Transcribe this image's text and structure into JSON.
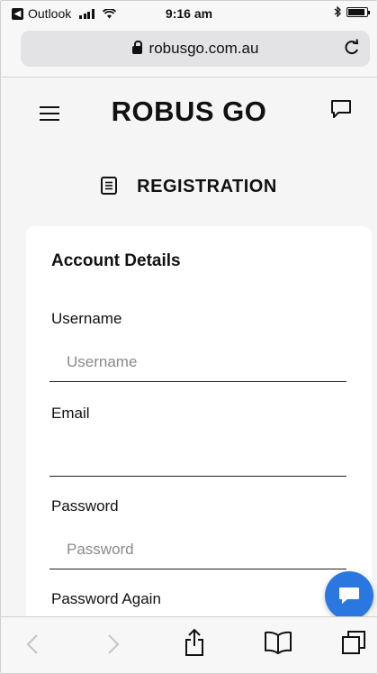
{
  "status_bar": {
    "carrier_app": "Outlook",
    "time": "9:16 am",
    "battery_level": 0.9
  },
  "browser": {
    "url": "robusgo.com.au"
  },
  "header": {
    "logo": "ROBUS GO"
  },
  "page": {
    "title": "REGISTRATION"
  },
  "form": {
    "section_title": "Account Details",
    "username": {
      "label": "Username",
      "placeholder": "Username",
      "value": ""
    },
    "email": {
      "label": "Email",
      "placeholder": "",
      "value": ""
    },
    "password": {
      "label": "Password",
      "placeholder": "Password",
      "value": ""
    },
    "password_again": {
      "label": "Password Again"
    }
  },
  "icons": {
    "status": [
      "back-to-app-icon",
      "signal-icon",
      "wifi-icon",
      "bluetooth-icon",
      "battery-icon"
    ],
    "browser": [
      "lock-icon",
      "reload-icon"
    ],
    "nav": [
      "hamburger-menu-icon",
      "chat-icon"
    ],
    "title": "document-icon",
    "toolbar": [
      "back-arrow-icon",
      "forward-arrow-icon",
      "share-icon",
      "bookmarks-icon",
      "tabs-icon"
    ],
    "fab": "chat-bubble-icon"
  },
  "colors": {
    "accent": "#2a78df",
    "page_background": "#f5f5f6",
    "card_background": "#ffffff"
  }
}
